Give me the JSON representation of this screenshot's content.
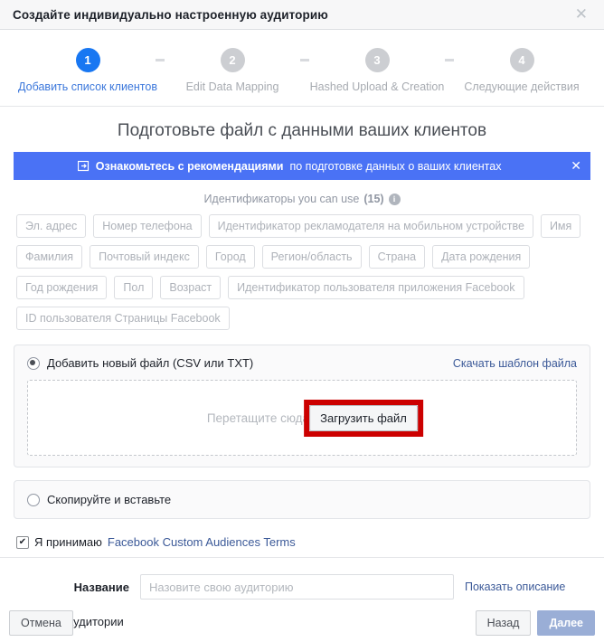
{
  "window": {
    "title": "Создайте индивидуально настроенную аудиторию",
    "close_icon": "close-icon",
    "close_glyph": "✕"
  },
  "stepper": {
    "steps": [
      {
        "number": "1",
        "label": "Добавить список клиентов",
        "state": "active"
      },
      {
        "number": "2",
        "label": "Edit Data Mapping",
        "state": "inactive"
      },
      {
        "number": "3",
        "label": "Hashed Upload & Creation",
        "state": "inactive"
      },
      {
        "number": "4",
        "label": "Следующие действия",
        "state": "inactive"
      }
    ],
    "active_color": "#1877f2",
    "inactive_color": "#ccced2"
  },
  "main": {
    "title": "Подготовьте файл с данными ваших клиентов",
    "banner": {
      "icon": "external-link-icon",
      "strong_text": "Ознакомьтесь с рекомендациями",
      "rest_text": "по подготовке данных о ваших клиентах",
      "close_glyph": "✕",
      "background": "#4a72f5"
    },
    "identifiers": {
      "heading": "Идентификаторы you can use",
      "count": "(15)",
      "info_glyph": "i",
      "tags": [
        "Эл. адрес",
        "Номер телефона",
        "Идентификатор рекламодателя на мобильном устройстве",
        "Имя",
        "Фамилия",
        "Почтовый индекс",
        "Город",
        "Регион/область",
        "Страна",
        "Дата рождения",
        "Год рождения",
        "Пол",
        "Возраст",
        "Идентификатор пользователя приложения Facebook",
        "ID пользователя Страницы Facebook"
      ]
    },
    "upload_card": {
      "radio_label": "Добавить новый файл (CSV или TXT)",
      "radio_checked": true,
      "template_link": "Скачать шаблон файла",
      "dropzone_text": "Перетащите сюда свой файл или",
      "upload_button": "Загрузить файл",
      "highlight_color": "#cc0000"
    },
    "paste_card": {
      "radio_label": "Скопируйте и вставьте",
      "radio_checked": false
    },
    "terms": {
      "checked": true,
      "text": "Я принимаю",
      "link_text": "Facebook Custom Audiences Terms"
    }
  },
  "footer": {
    "name_label": "Название",
    "name_placeholder": "Назовите свою аудиторию",
    "name_value": "",
    "description_link": "Показать описание",
    "stray_text": "аудитории",
    "cancel_button": "Отмена",
    "back_button": "Назад",
    "next_button": "Далее",
    "next_button_color": "#9aaed6"
  }
}
